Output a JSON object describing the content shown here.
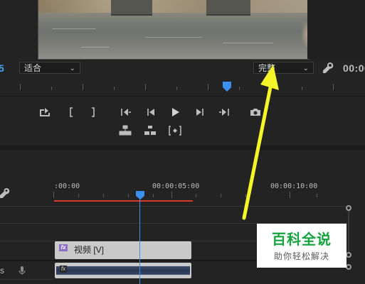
{
  "program_monitor": {
    "timecode_left_partial": "5",
    "fit_dropdown": {
      "value": "适合"
    },
    "quality_dropdown": {
      "value": "完整"
    },
    "timecode_right_partial": "00:00"
  },
  "transport": {
    "export_frame_icon": "camera-icon"
  },
  "timeline": {
    "ruler_labels": [
      ":00:00",
      "00:00:05:00",
      "00:00:10:00"
    ],
    "video_clip": {
      "fx": "fx",
      "label": "视频 [V]"
    },
    "audio_clip": {
      "fx": "fx"
    },
    "track_label_partial": "s"
  },
  "annotation": {
    "arrow_color": "#f5f52a"
  },
  "watermark": {
    "title": "百科全说",
    "subtitle": "助你轻松解决",
    "title_color": "#15a33e"
  },
  "colors": {
    "playhead": "#3b8ff0",
    "work_area_bar": "#d93a2b",
    "background": "#232323"
  }
}
